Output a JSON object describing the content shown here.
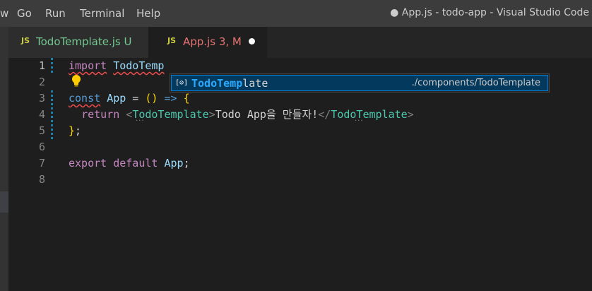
{
  "menu": {
    "partial": "w",
    "items": [
      "Go",
      "Run",
      "Terminal",
      "Help"
    ]
  },
  "window": {
    "title": "● App.js - todo-app - Visual Studio Code"
  },
  "tabs": [
    {
      "icon": "JS",
      "label": "TodoTemplate.js",
      "status": "U"
    },
    {
      "icon": "JS",
      "label": "App.js",
      "status": "3, M",
      "modified_dot": "●"
    }
  ],
  "editor": {
    "line_numbers": [
      "1",
      "2",
      "3",
      "4",
      "5",
      "6",
      "7",
      "8"
    ],
    "active_line": "1",
    "lines": [
      {
        "tokens": [
          [
            "kw",
            "import"
          ],
          [
            "plain",
            " "
          ],
          [
            "id",
            "TodoTemp"
          ]
        ]
      },
      {
        "tokens": []
      },
      {
        "tokens": [
          [
            "kw2",
            "const"
          ],
          [
            "plain",
            " "
          ],
          [
            "id",
            "App"
          ],
          [
            "plain",
            " = "
          ],
          [
            "brace",
            "()"
          ],
          [
            "plain",
            " "
          ],
          [
            "kw2",
            "=>"
          ],
          [
            "plain",
            " "
          ],
          [
            "brace",
            "{"
          ]
        ]
      },
      {
        "tokens": [
          [
            "plain",
            "  "
          ],
          [
            "kw",
            "return"
          ],
          [
            "plain",
            " "
          ],
          [
            "punc",
            "<"
          ],
          [
            "comp",
            "TodoTemplate"
          ],
          [
            "punc",
            ">"
          ],
          [
            "plain",
            "Todo App을 만들자!"
          ],
          [
            "punc",
            "</"
          ],
          [
            "comp",
            "TodoTemplate"
          ],
          [
            "punc",
            ">"
          ]
        ]
      },
      {
        "tokens": [
          [
            "brace",
            "}"
          ],
          [
            "plain",
            ";"
          ]
        ]
      },
      {
        "tokens": []
      },
      {
        "tokens": [
          [
            "kw",
            "export"
          ],
          [
            "plain",
            " "
          ],
          [
            "kw",
            "default"
          ],
          [
            "plain",
            " "
          ],
          [
            "id",
            "App"
          ],
          [
            "plain",
            ";"
          ]
        ]
      },
      {
        "tokens": []
      }
    ]
  },
  "suggestion": {
    "icon": "[⊘]",
    "match": "TodoTemp",
    "rest": "late",
    "detail": "./components/TodoTemplate"
  },
  "colors": {
    "keyword": "#c586c0",
    "storage": "#569cd6",
    "identifier": "#9cdcfe",
    "component": "#4ec9b0",
    "modified_tab": "#e57373",
    "untracked_tab": "#73c991",
    "suggest_highlight": "#2aaaff"
  },
  "icons": [
    "lightbulb-icon",
    "symbol-variable-icon",
    "js-file-icon"
  ]
}
